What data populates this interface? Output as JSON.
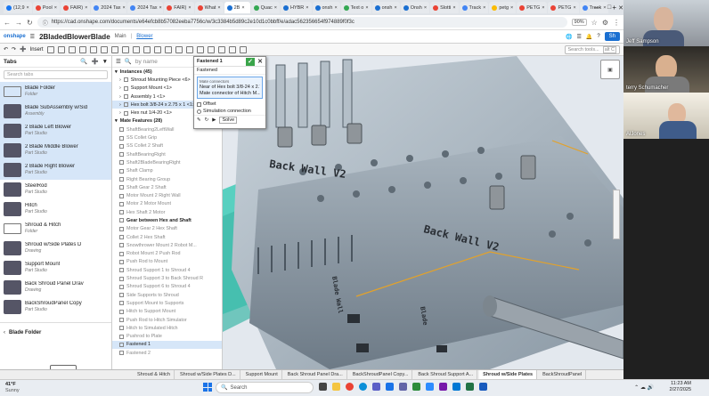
{
  "browser": {
    "tabs": [
      {
        "label": "(12,9",
        "color": "#1877f2"
      },
      {
        "label": "Pool",
        "color": "#ea4335"
      },
      {
        "label": "FAIR)",
        "color": "#ea4335"
      },
      {
        "label": "2024 Tax",
        "color": "#4285f4"
      },
      {
        "label": "2024 Tax",
        "color": "#4285f4"
      },
      {
        "label": "FAIR)",
        "color": "#ea4335"
      },
      {
        "label": "What",
        "color": "#ea4335"
      },
      {
        "label": "2B",
        "color": "#1a6fd1",
        "active": true
      },
      {
        "label": "Quac",
        "color": "#34a853"
      },
      {
        "label": "HYBR",
        "color": "#1a6fd1"
      },
      {
        "label": "onsh",
        "color": "#1a6fd1"
      },
      {
        "label": "Text o",
        "color": "#34a853"
      },
      {
        "label": "onsh",
        "color": "#1a6fd1"
      },
      {
        "label": "Onsh",
        "color": "#1a6fd1"
      },
      {
        "label": "Slotti",
        "color": "#ea4335"
      },
      {
        "label": "Track",
        "color": "#4285f4"
      },
      {
        "label": "petg",
        "color": "#fbbc05"
      },
      {
        "label": "PETG",
        "color": "#ea4335"
      },
      {
        "label": "PETG",
        "color": "#ea4335"
      },
      {
        "label": "Track",
        "color": "#4285f4"
      }
    ],
    "url": "https://cad.onshape.com/documents/e64efcb8b57082eeba7756c/w/3c3384b5d89c2e10d1c0bbff/e/adac562356654f974889f0f3c",
    "zoom": "90%"
  },
  "onshape": {
    "logo": "onshape",
    "doc_name": "2BladedBlowerBlade",
    "branch": "Main",
    "folder": "Blower",
    "insert_label": "Insert",
    "search_tools": "Search tools...",
    "shortcut": "alt C",
    "share_label": "Sh"
  },
  "tabs_panel": {
    "title": "Tabs",
    "search_placeholder": "Search tabs",
    "items": [
      {
        "name": "Blade Folder",
        "type": "Folder",
        "folder": true,
        "selected": true
      },
      {
        "name": "Blade SubAssembly w/Sid",
        "type": "Assembly",
        "selected": true
      },
      {
        "name": "2 Blade Left Blower",
        "type": "Part Studio",
        "selected": true
      },
      {
        "name": "2 Blade Middle Blower",
        "type": "Part Studio",
        "selected": true
      },
      {
        "name": "2 Blade Right Blower",
        "type": "Part Studio",
        "selected": true
      },
      {
        "name": "SteelRod",
        "type": "Part Studio"
      },
      {
        "name": "Hitch",
        "type": "Part Studio"
      },
      {
        "name": "Shroud & Hitch",
        "type": "Folder",
        "folder": true
      },
      {
        "name": "Shroud w/Side Plates D",
        "type": "Drawing"
      },
      {
        "name": "Support Mount",
        "type": "Part Studio"
      },
      {
        "name": "Back Shroud Panel Drav",
        "type": "Drawing"
      },
      {
        "name": "BackShroudPanel Copy",
        "type": "Part Studio"
      }
    ],
    "lower_folder": "Blade Folder"
  },
  "features_panel": {
    "instances_header": "Instances (45)",
    "instances": [
      {
        "label": "Shroud Mounting Piece <6>",
        "dim": false
      },
      {
        "label": "Support Mount <1>",
        "dim": false
      },
      {
        "label": "Assembly 1 <1>",
        "dim": false
      },
      {
        "label": "Hex bolt 3/8-24 x 2.75 x 1 <1>",
        "dim": false,
        "highlight": true
      },
      {
        "label": "Hex nut 1/4-20 <1>",
        "dim": false
      }
    ],
    "mate_header": "Mate Features (28)",
    "mates": [
      "ShaftBearing2LeftWall",
      "SS Collet Grip",
      "SS Collet 2 Shaft",
      "ShaftBearingRight",
      "Shaft2BladeBearingRight",
      "Shaft Clamp",
      "Right Bearing Group",
      "Shaft Gear 2 Shaft",
      "Motor Mount 2 Right Wall",
      "Motor 2 Motor Mount",
      "Hex Shaft 2 Motor",
      "Gear between Hex and Shaft",
      "Motor Gear 2 Hex Shaft",
      "Collet 2 Hex Shaft",
      "Snowthrower Mount 2 Robot M...",
      "Robot Mount 2 Push Rod",
      "Push Rod to Mount",
      "Shroud Support 1 to Shroud 4",
      "Shroud Support 3 to Back Shroud R",
      "Shroud Support 6 to Shroud 4",
      "Side Supports to Shroud",
      "Support Mount to Supports",
      "Hitch to Support Mount",
      "Push Rod to Hitch Simulator",
      "Hitch to Simulated Hitch",
      "Pushrod to Plate",
      "Fastened 1",
      "Fastened 2"
    ],
    "bold_mates": [
      "Gear between Hex and Shaft"
    ],
    "highlight_mates": [
      "Fastened 1"
    ]
  },
  "dialog": {
    "title": "Fastened 1",
    "type_label": "Fastened",
    "mate_connectors_label": "Mate connectors",
    "connector_1": "Near of Hex bolt 3/8-24 x 2.75 ...",
    "connector_2": "Mate connector of Hitch M...",
    "offset_label": "Offset",
    "simulation_label": "Simulation connection",
    "solve_label": "Solve"
  },
  "viewport": {
    "label_1": "Back Wall V2",
    "label_2": "Back Wall V2",
    "label_3": "Blade Wall",
    "label_4": "Blade"
  },
  "bottom_tabs": [
    {
      "label": "Shroud & Hitch"
    },
    {
      "label": "Shroud w/Side Plates D..."
    },
    {
      "label": "Support Mount"
    },
    {
      "label": "Back Shroud Panel Dra..."
    },
    {
      "label": "BackShroudPanel Copy..."
    },
    {
      "label": "Back Shroud Support A..."
    },
    {
      "label": "Shroud w/Side Plates",
      "active": true
    },
    {
      "label": "BackShroudPanel"
    }
  ],
  "taskbar": {
    "weather_temp": "41°F",
    "weather_text": "Sunny",
    "search_placeholder": "Search",
    "time": "11:23 AM",
    "date": "2/27/2025"
  },
  "participants": [
    {
      "name": "Jeff Sampson"
    },
    {
      "name": "terry Schumacher"
    },
    {
      "name": "AlJones"
    }
  ]
}
